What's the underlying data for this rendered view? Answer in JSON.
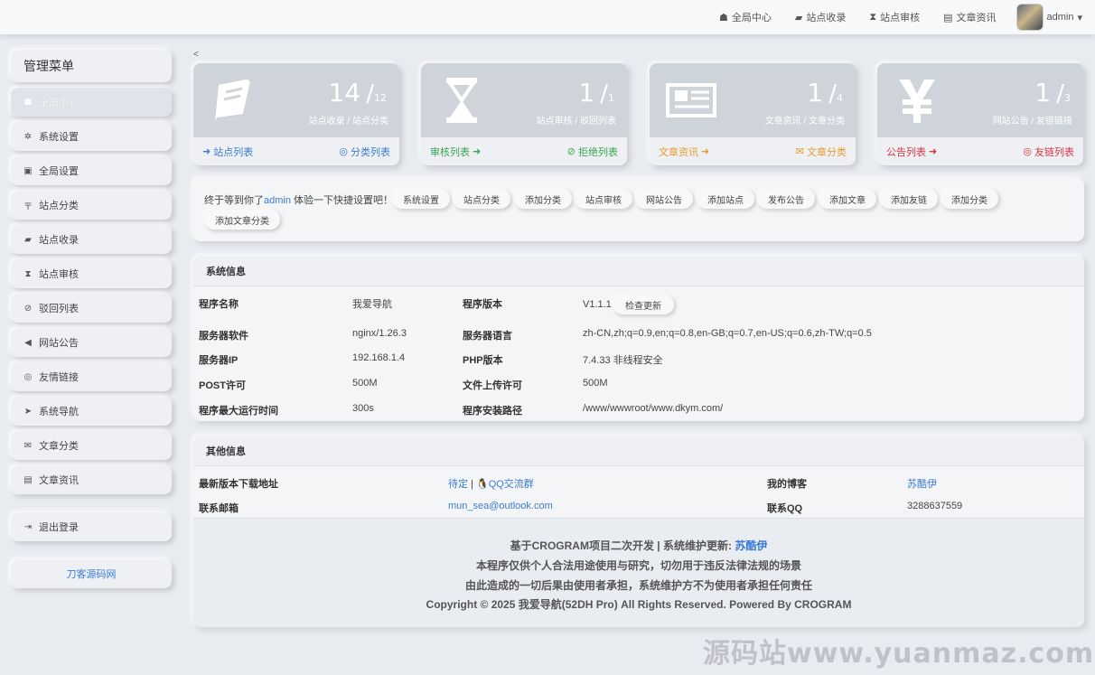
{
  "topbar": {
    "nav": [
      {
        "icon": "dashboard-icon",
        "glyph": "☗",
        "label": "全局中心"
      },
      {
        "icon": "book-icon",
        "glyph": "▰",
        "label": "站点收录"
      },
      {
        "icon": "hourglass-icon",
        "glyph": "⧗",
        "label": "站点审核"
      },
      {
        "icon": "newspaper-icon",
        "glyph": "▤",
        "label": "文章资讯"
      }
    ],
    "user": "admin",
    "caret": "▾"
  },
  "sidebar": {
    "title": "管理菜单",
    "items": [
      {
        "icon": "dashboard-icon",
        "glyph": "☗",
        "label": "全局中心",
        "active": true
      },
      {
        "icon": "gear-icon",
        "glyph": "✲",
        "label": "系统设置"
      },
      {
        "icon": "image-icon",
        "glyph": "▣",
        "label": "全局设置"
      },
      {
        "icon": "category-icon",
        "glyph": "〒",
        "label": "站点分类"
      },
      {
        "icon": "book-icon",
        "glyph": "▰",
        "label": "站点收录"
      },
      {
        "icon": "hourglass-icon",
        "glyph": "⧗",
        "label": "站点审核"
      },
      {
        "icon": "ban-icon",
        "glyph": "⊘",
        "label": "驳回列表"
      },
      {
        "icon": "bullhorn-icon",
        "glyph": "◀",
        "label": "网站公告"
      },
      {
        "icon": "handshake-icon",
        "glyph": "◎",
        "label": "友情链接"
      },
      {
        "icon": "location-arrow-icon",
        "glyph": "➤",
        "label": "系统导航"
      },
      {
        "icon": "envelope-icon",
        "glyph": "✉",
        "label": "文章分类"
      },
      {
        "icon": "newspaper-icon",
        "glyph": "▤",
        "label": "文章资讯"
      }
    ],
    "logout": {
      "icon": "sign-out-icon",
      "glyph": "⇥",
      "label": "退出登录"
    },
    "brand": "刀客源码网"
  },
  "collapse": "<",
  "stats": [
    {
      "num": "14",
      "total": "12",
      "sub": "站点收录 / 站点分类",
      "left": "站点列表",
      "right": "分类列表",
      "left_color": "#3a7bd5",
      "right_color": "#3a7bd5",
      "left_glyph": "➜",
      "right_glyph": "◎"
    },
    {
      "num": "1",
      "total": "1",
      "sub": "站点审核 / 驳回列表",
      "left": "审核列表",
      "right": "拒绝列表",
      "left_color": "#3aa655",
      "right_color": "#3aa655",
      "left_glyph": "➜",
      "right_glyph": "⊘"
    },
    {
      "num": "1",
      "total": "4",
      "sub": "文章资讯 / 文章分类",
      "left": "文章资讯",
      "right": "文章分类",
      "left_color": "#e89a2c",
      "right_color": "#e89a2c",
      "left_glyph": "➜",
      "right_glyph": "✉"
    },
    {
      "num": "1",
      "total": "3",
      "sub": "网站公告 / 友链链接",
      "left": "公告列表",
      "right": "友链列表",
      "left_color": "#d9363e",
      "right_color": "#d9363e",
      "left_glyph": "➜",
      "right_glyph": "◎"
    }
  ],
  "quick": {
    "prefix": "终于等到你了",
    "user": "admin",
    "suffix": " 体验一下快捷设置吧！",
    "buttons": [
      "系统设置",
      "站点分类",
      "添加分类",
      "站点审核",
      "网站公告",
      "添加站点",
      "发布公告",
      "添加文章",
      "添加友链",
      "添加分类",
      "添加文章分类"
    ]
  },
  "sysinfo": {
    "title": "系统信息",
    "rows": [
      {
        "k1": "程序名称",
        "v1": "我爱导航",
        "k2": "程序版本",
        "v2": "V1.1.1"
      },
      {
        "k1": "服务器软件",
        "v1": "nginx/1.26.3",
        "k2": "服务器语言",
        "v2": "zh-CN,zh;q=0.9,en;q=0.8,en-GB;q=0.7,en-US;q=0.6,zh-TW;q=0.5"
      },
      {
        "k1": "服务器IP",
        "v1": "192.168.1.4",
        "k2": "PHP版本",
        "v2": "7.4.33 非线程安全"
      },
      {
        "k1": "POST许可",
        "v1": "500M",
        "k2": "文件上传许可",
        "v2": "500M"
      },
      {
        "k1": "程序最大运行时间",
        "v1": "300s",
        "k2": "程序安装路径",
        "v2": "/www/wwwroot/www.dkym.com/"
      }
    ],
    "update_btn": "检查更新"
  },
  "otherinfo": {
    "title": "其他信息",
    "download_label": "最新版本下载地址",
    "download_pending": "待定",
    "sep": "|",
    "qq_group": "QQ交流群",
    "blog_label": "我的博客",
    "blog_value": "苏酷伊",
    "email_label": "联系邮箱",
    "email_value": "mun_sea@outlook.com",
    "qq_label": "联系QQ",
    "qq_value": "3288637559"
  },
  "footer": {
    "line1_prefix": "基于CROGRAM项目二次开发 | 系统维护更新: ",
    "line1_name": "苏酷伊",
    "line2": "本程序仅供个人合法用途使用与研究，切勿用于违反法律法规的场景",
    "line3": "由此造成的一切后果由使用者承担，系统维护方不为使用者承担任何责任",
    "line4": "Copyright © 2025 我爱导航(52DH Pro) All Rights Reserved. Powered By CROGRAM"
  },
  "watermark": "源码站www.yuanmaz.com"
}
